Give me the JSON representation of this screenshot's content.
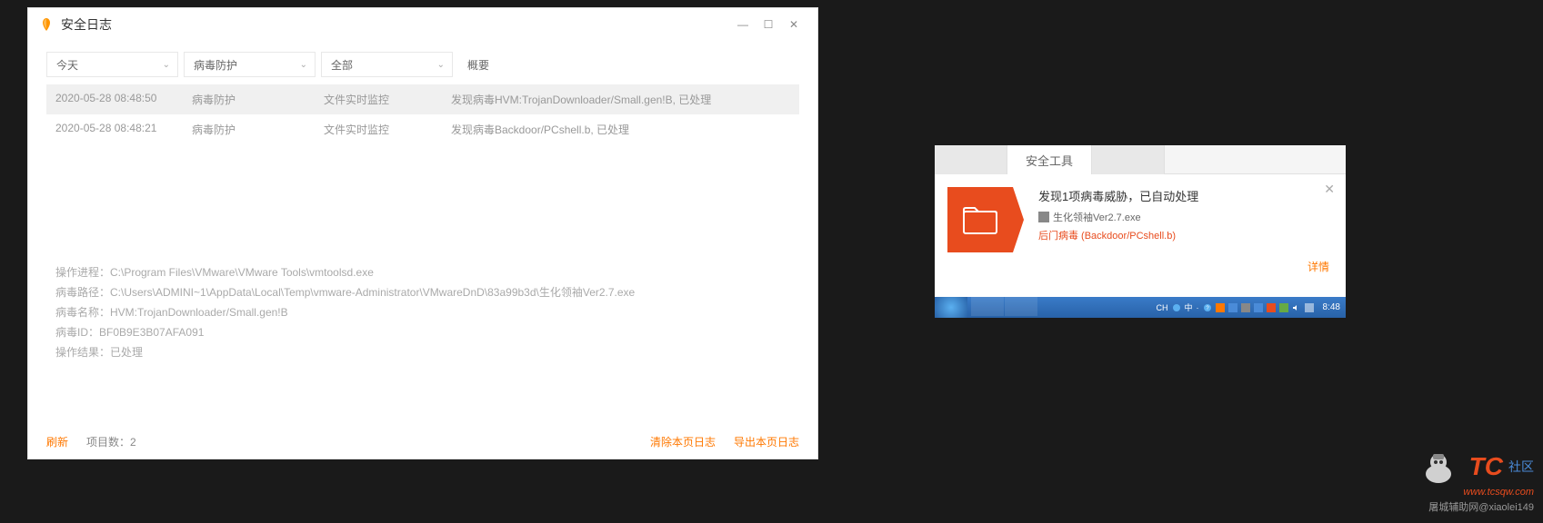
{
  "logWindow": {
    "title": "安全日志",
    "filters": {
      "date": "今天",
      "type": "病毒防护",
      "scope": "全部"
    },
    "summaryHeader": "概要",
    "rows": [
      {
        "time": "2020-05-28 08:48:50",
        "type": "病毒防护",
        "event": "文件实时监控",
        "summary": "发现病毒HVM:TrojanDownloader/Small.gen!B, 已处理"
      },
      {
        "time": "2020-05-28 08:48:21",
        "type": "病毒防护",
        "event": "文件实时监控",
        "summary": "发现病毒Backdoor/PCshell.b, 已处理"
      }
    ],
    "details": {
      "process": "操作进程：C:\\Program Files\\VMware\\VMware Tools\\vmtoolsd.exe",
      "path": "病毒路径：C:\\Users\\ADMINI~1\\AppData\\Local\\Temp\\vmware-Administrator\\VMwareDnD\\83a99b3d\\生化领袖Ver2.7.exe",
      "name": "病毒名称：HVM:TrojanDownloader/Small.gen!B",
      "id": "病毒ID：BF0B9E3B07AFA091",
      "result": "操作结果：已处理"
    },
    "footer": {
      "refresh": "刷新",
      "count": "项目数：2",
      "clear": "清除本页日志",
      "export": "导出本页日志"
    }
  },
  "popup": {
    "tab": "安全工具",
    "title": "发现1项病毒威胁，已自动处理",
    "file": "生化领袖Ver2.7.exe",
    "threat": "后门病毒 (Backdoor/PCshell.b)",
    "detailLink": "详情"
  },
  "taskbar": {
    "lang": "CH",
    "ime": "中",
    "time": "8:48"
  },
  "watermark": {
    "big": "TC",
    "small": "社区",
    "url": "www.tcsqw.com",
    "handle": "屠城辅助网@xiaolei149"
  }
}
